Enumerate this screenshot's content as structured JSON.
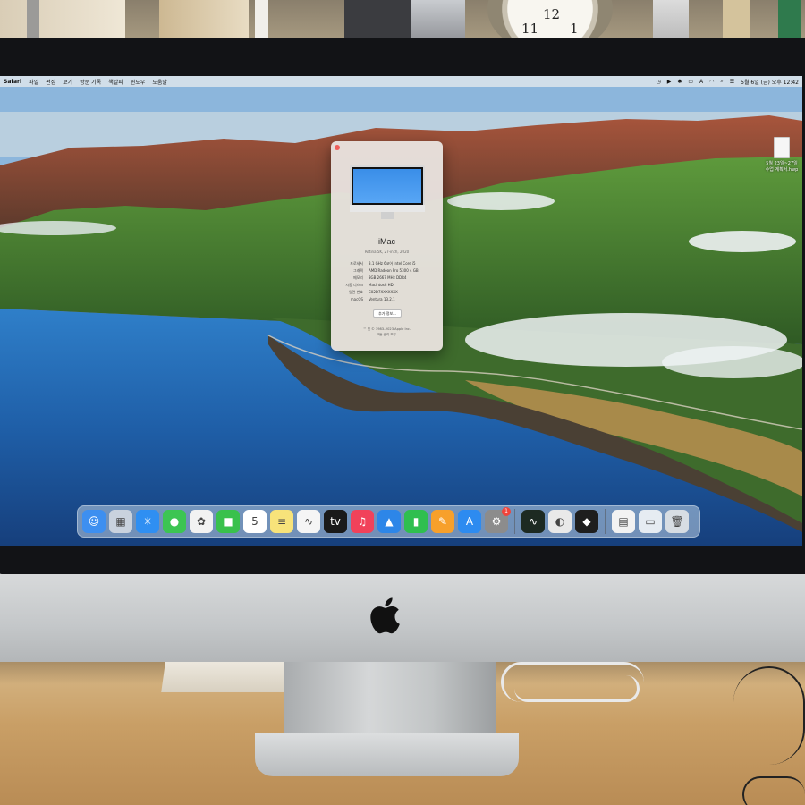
{
  "menubar": {
    "app_name": "Safari",
    "items": [
      "파일",
      "편집",
      "보기",
      "방문 기록",
      "책갈피",
      "윈도우",
      "도움말"
    ],
    "status_icons": [
      "clock-icon",
      "play-icon",
      "bluetooth-icon",
      "battery-icon",
      "wifi-icon",
      "search-icon",
      "control-center-icon"
    ],
    "input_label": "A",
    "datetime": "5월 6일 (금) 오후 12:42"
  },
  "desktop_file": {
    "name": "5월 23일~27일 수업 계획서.hwp"
  },
  "about_window": {
    "title": "iMac",
    "subtitle": "Retina 5K, 27-inch, 2020",
    "specs": [
      {
        "key": "프로세서",
        "value": "3.1 GHz 6코어 Intel Core i5"
      },
      {
        "key": "그래픽",
        "value": "AMD Radeon Pro 5300 4 GB"
      },
      {
        "key": "메모리",
        "value": "8GB 2667 MHz DDR4"
      },
      {
        "key": "시동 디스크",
        "value": "Macintosh HD"
      },
      {
        "key": "일련 번호",
        "value": "C02D7XXXXXXX"
      },
      {
        "key": "macOS",
        "value": "Ventura 13.2.1"
      }
    ],
    "more_button": "추가 정보...",
    "copyright": [
      "™ 및 © 1983–2023 Apple Inc.",
      "모든 권리 보유."
    ]
  },
  "dock": {
    "apps": [
      {
        "name": "finder-icon",
        "glyph": "☺",
        "color": "#3d8ff0"
      },
      {
        "name": "launchpad-icon",
        "glyph": "▦",
        "color": "#c9d2de"
      },
      {
        "name": "safari-icon",
        "glyph": "✳",
        "color": "#2f8ff2"
      },
      {
        "name": "messages-icon",
        "glyph": "●",
        "color": "#3cc552"
      },
      {
        "name": "photos-icon",
        "glyph": "✿",
        "color": "#f2f2f2"
      },
      {
        "name": "facetime-icon",
        "glyph": "■",
        "color": "#39c14c"
      },
      {
        "name": "calendar-icon",
        "glyph": "5",
        "color": "#ffffff"
      },
      {
        "name": "notes-icon",
        "glyph": "≡",
        "color": "#f7e37a"
      },
      {
        "name": "freeform-icon",
        "glyph": "∿",
        "color": "#f5f5f5"
      },
      {
        "name": "apple-tv-icon",
        "glyph": "tv",
        "color": "#1a1a1a"
      },
      {
        "name": "music-icon",
        "glyph": "♫",
        "color": "#f1425a"
      },
      {
        "name": "keynote-icon",
        "glyph": "▲",
        "color": "#2d86e8"
      },
      {
        "name": "numbers-icon",
        "glyph": "▮",
        "color": "#2fbf4f"
      },
      {
        "name": "pages-icon",
        "glyph": "✎",
        "color": "#f7a02b"
      },
      {
        "name": "app-store-icon",
        "glyph": "A",
        "color": "#2d8bf0"
      },
      {
        "name": "system-settings-icon",
        "glyph": "⚙",
        "color": "#8c8c8c",
        "badge": "1"
      }
    ],
    "apps2": [
      {
        "name": "activity-monitor-icon",
        "glyph": "∿",
        "color": "#1d2a22"
      },
      {
        "name": "preview-icon",
        "glyph": "◐",
        "color": "#e9e9e9"
      },
      {
        "name": "figma-icon",
        "glyph": "◆",
        "color": "#1e1e1e"
      }
    ],
    "stack": [
      {
        "name": "documents-stack-icon",
        "glyph": "▤",
        "color": "#f2f2f2"
      },
      {
        "name": "downloads-stack-icon",
        "glyph": "▭",
        "color": "#e6ecf2"
      },
      {
        "name": "trash-icon",
        "glyph": "🗑",
        "color": "#d7dde3"
      }
    ]
  }
}
